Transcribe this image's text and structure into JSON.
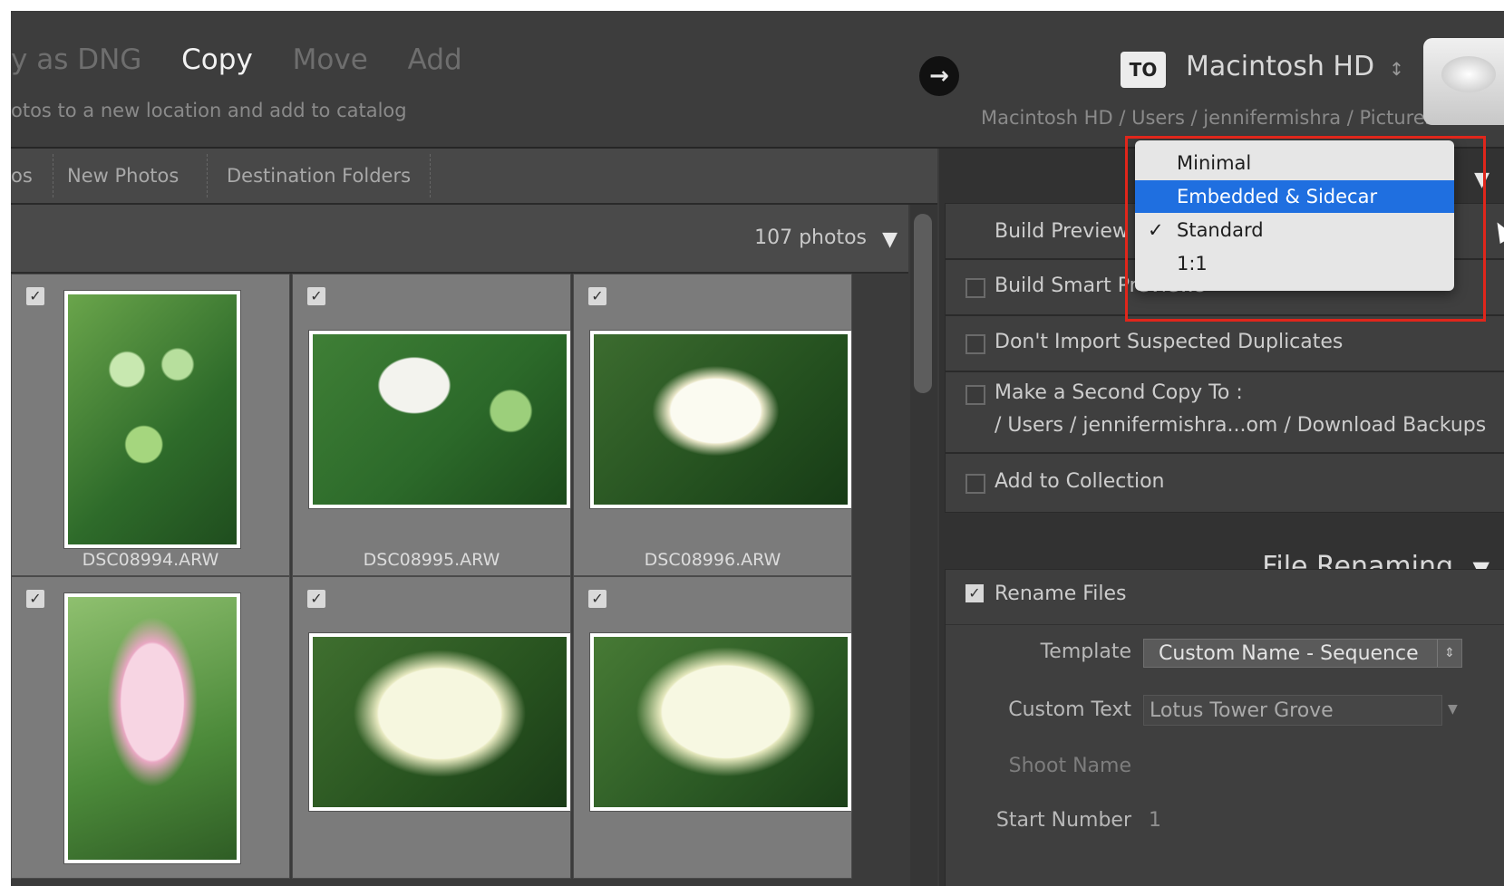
{
  "header": {
    "modes": [
      "y as DNG",
      "Copy",
      "Move",
      "Add"
    ],
    "active_mode": "Copy",
    "mode_description": "otos to a new location and add to catalog",
    "to_label": "TO",
    "destination_volume": "Macintosh HD",
    "destination_chevron": "↕",
    "destination_path": "Macintosh HD / Users / jennifermishra / Pictures"
  },
  "tabs": [
    "os",
    "New Photos",
    "Destination Folders"
  ],
  "grid": {
    "photo_count": "107 photos",
    "sort_arrow": "▼",
    "items": [
      {
        "filename": "DSC08994.ARW",
        "checked": true
      },
      {
        "filename": "DSC08995.ARW",
        "checked": true
      },
      {
        "filename": "DSC08996.ARW",
        "checked": true
      },
      {
        "filename": "",
        "checked": true
      },
      {
        "filename": "",
        "checked": true
      },
      {
        "filename": "",
        "checked": true
      }
    ]
  },
  "file_handling": {
    "build_previews_label": "Build Preview",
    "build_smart_previews_label": "Build Smart Previews",
    "dont_import_duplicates_label": "Don't Import Suspected Duplicates",
    "second_copy_label": "Make a Second Copy To :",
    "second_copy_path": "/ Users / jennifermishra...om / Download Backups",
    "add_to_collection_label": "Add to Collection"
  },
  "preview_menu": {
    "options": [
      "Minimal",
      "Embedded & Sidecar",
      "Standard",
      "1:1"
    ],
    "hovered": "Embedded & Sidecar",
    "checked": "Standard",
    "checkmark": "✓"
  },
  "file_renaming": {
    "section_title": "File Renaming",
    "collapse_arrow": "▼",
    "rename_files_label": "Rename Files",
    "template_label": "Template",
    "template_value": "Custom Name - Sequence",
    "custom_text_label": "Custom Text",
    "custom_text_value": "Lotus Tower Grove",
    "shoot_name_label": "Shoot Name",
    "start_number_label": "Start Number",
    "start_number_value": "1"
  },
  "colors": {
    "accent_blue": "#1f6fe0",
    "highlight_red": "#e0261b",
    "panel_bg": "#3f3f3f"
  }
}
